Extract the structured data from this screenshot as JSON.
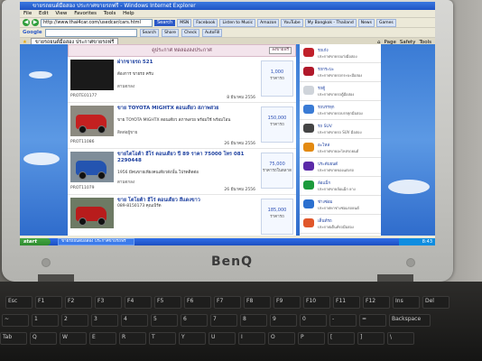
{
  "browser": {
    "title": "ขายรถยนต์มือสอง ประกาศขายรถฟรี - Windows Internet Explorer",
    "menu": [
      "File",
      "Edit",
      "View",
      "Favorites",
      "Tools",
      "Help"
    ],
    "url": "http://www.thai4car.com/usedcar/cars.html",
    "go_label": "Search",
    "toolbar_chips": [
      "MSN",
      "Facebook",
      "Listen to Music",
      "Amazon",
      "YouTube",
      "My Bangkok - Thailand",
      "News",
      "Games"
    ],
    "google_label": "Google",
    "google_chips": [
      "Search",
      "Share",
      "Check",
      "AutoFill"
    ],
    "tab_label": "ขายรถยนต์มือสอง ประกาศขายรถฟรี",
    "tab_tools": [
      "Page",
      "Safety",
      "Tools"
    ]
  },
  "page": {
    "announce_label": "ดูประกาศ ทดลองลงประกาศ",
    "announce_button": "ลงขายฟรี",
    "listings": [
      {
        "title": "ฝากขายรถ 521",
        "sub": "ต้องการ ขายรถ ครับ",
        "meta": "ตามตกลง",
        "id": "PROTE01177",
        "date": "8 มีนาคม 2556",
        "price": "1,000",
        "price_label": "ราคารถ"
      },
      {
        "title": "ขาย TOYOTA MIGHTX ตอนเดียว สภาพสวย",
        "sub": "ขาย TOYOTA MIGHTX ตอนเดียว สภาพสวย พร้อมใช้ พร้อมโอน",
        "meta": "ติดต่อผู้ขาย",
        "id": "PROT11086",
        "date": "26 มีนาคม 2556",
        "price": "150,000",
        "price_label": "ราคารถ"
      },
      {
        "title": "ขายไตโอต้า ฮีโร่ ตอนเดียว ปี 89 ราคา 75000 โทร 081 2290448",
        "sub": "1956 มีคนขายเพียงคนเดียวดังนั้น โปรดติดต่อ",
        "meta": "ตามตกลง",
        "id": "PROT11079",
        "date": "26 มีนาคม 2556",
        "price": "75,000",
        "price_label": "ราคารถในตลาด"
      },
      {
        "title": "ขาย โตโยต้า ฮีโร่ ตอนเดียว สีแดงขาว",
        "sub": "089-8150173 คุณเบิร์ด",
        "meta": "",
        "id": "",
        "date": "",
        "price": "185,000",
        "price_label": "ราคารถ"
      }
    ],
    "sidebar": [
      {
        "name": "รถเก๋ง",
        "desc": "ประกาศขายรถเก๋งมือสอง"
      },
      {
        "name": "รถกระบะ",
        "desc": "ประกาศขายรถกระบะมือสอง"
      },
      {
        "name": "รถตู้",
        "desc": "ประกาศขายรถตู้มือสอง"
      },
      {
        "name": "รถบรรทุก",
        "desc": "ประกาศขายรถบรรทุกมือสอง"
      },
      {
        "name": "รถ SUV",
        "desc": "ประกาศขายรถ SUV มือสอง"
      },
      {
        "name": "อะไหล่",
        "desc": "ประกาศขายอะไหล่รถยนต์"
      },
      {
        "name": "ประดับยนต์",
        "desc": "ประกาศขายของแต่งรถ"
      },
      {
        "name": "ล้อแม็ก",
        "desc": "ประกาศขายล้อแม็ก ยาง"
      },
      {
        "name": "ช่างซ่อม",
        "desc": "ประกาศหาช่างซ่อมรถยนต์"
      },
      {
        "name": "เต็นท์รถ",
        "desc": "ประกาศเต็นท์รถมือสอง"
      },
      {
        "name": "อื่นๆ",
        "desc": "ประกาศขายสินค้าอื่นๆ"
      }
    ]
  },
  "taskbar": {
    "start_label": "start",
    "task_label": "ขายรถยนต์มือสอง ประกาศขายรถฟรี",
    "clock": "8:43"
  },
  "laptop": {
    "brand": "BenQ"
  },
  "keyboard": {
    "row1": [
      "Esc",
      "F1",
      "F2",
      "F3",
      "F4",
      "F5",
      "F6",
      "F7",
      "F8",
      "F9",
      "F10",
      "F11",
      "F12",
      "Ins",
      "Del"
    ],
    "row2": [
      "~",
      "1",
      "2",
      "3",
      "4",
      "5",
      "6",
      "7",
      "8",
      "9",
      "0",
      "-",
      "=",
      "Backspace"
    ],
    "row3": [
      "Tab",
      "Q",
      "W",
      "E",
      "R",
      "T",
      "Y",
      "U",
      "I",
      "O",
      "P",
      "[",
      "]",
      "\\"
    ]
  },
  "colors": {
    "ie_blue": "#1f54c4",
    "listing_title": "#1c3f9f",
    "xp_start_green": "#2e8a2e"
  }
}
